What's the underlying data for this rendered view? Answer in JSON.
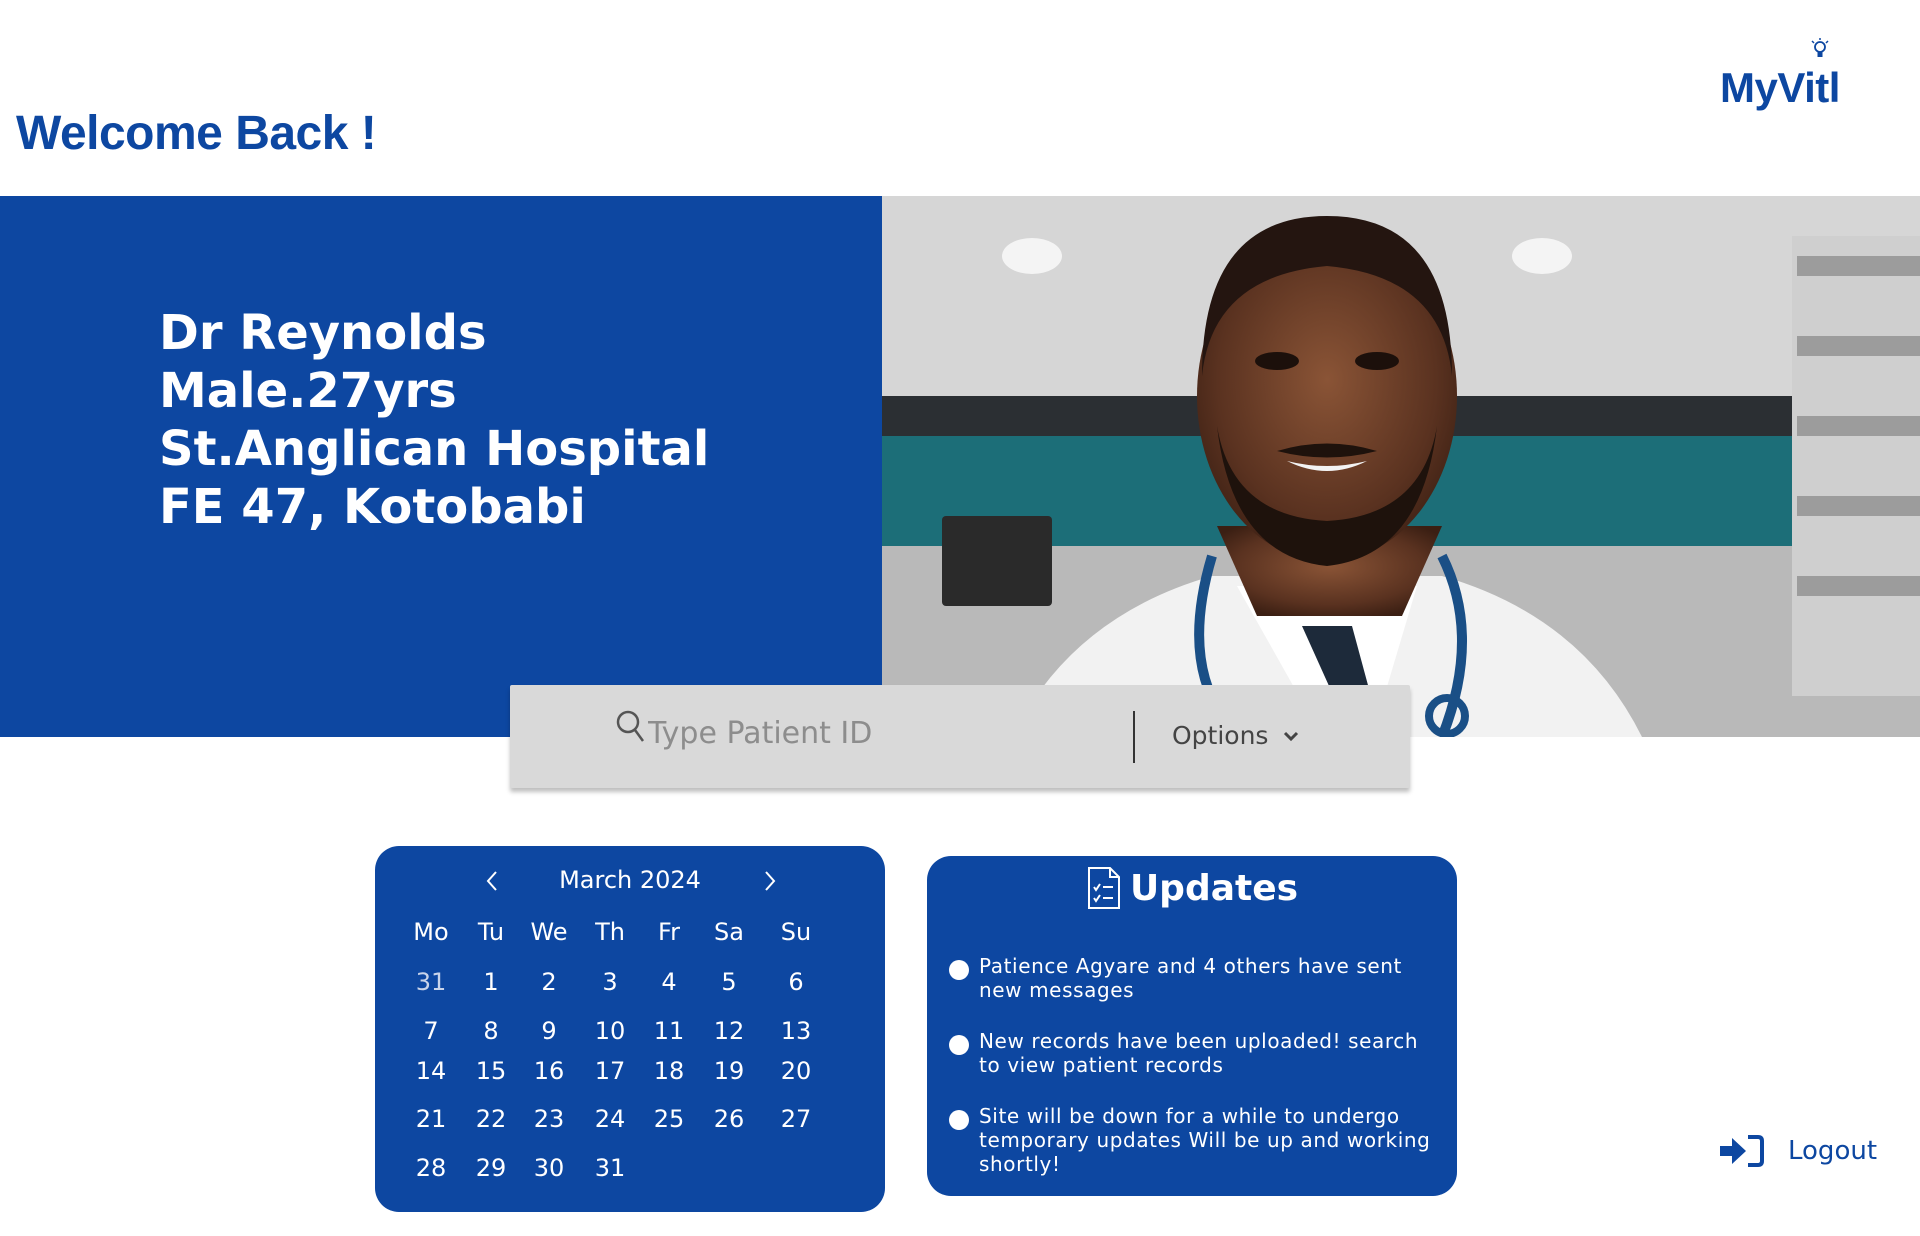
{
  "brand": {
    "name": "MyVitl",
    "icon": "lightbulb-icon",
    "color": "#0d47a1"
  },
  "header": {
    "welcome": "Welcome Back !"
  },
  "profile": {
    "name": "Dr Reynolds",
    "gender_age": "Male.27yrs",
    "hospital": "St.Anglican Hospital",
    "address": "FE 47, Kotobabi",
    "photo_description": "doctor-portrait"
  },
  "search": {
    "placeholder": "Type Patient ID",
    "value": "",
    "options_label": "Options"
  },
  "calendar": {
    "month_label": "March 2024",
    "weekdays": [
      "Mo",
      "Tu",
      "We",
      "Th",
      "Fr",
      "Sa",
      "Su"
    ],
    "weeks": [
      [
        "31",
        "1",
        "2",
        "3",
        "4",
        "5",
        "6"
      ],
      [
        "7",
        "8",
        "9",
        "10",
        "11",
        "12",
        "13"
      ],
      [
        "14",
        "15",
        "16",
        "17",
        "18",
        "19",
        "20"
      ],
      [
        "21",
        "22",
        "23",
        "24",
        "25",
        "26",
        "27"
      ],
      [
        "28",
        "29",
        "30",
        "31",
        "",
        "",
        ""
      ]
    ]
  },
  "updates": {
    "title": "Updates",
    "icon": "checklist-document-icon",
    "items": [
      "Patience Agyare and 4 others have sent new messages",
      "New records have been uploaded! search to view patient records",
      "Site will be down for a while to undergo temporary updates Will be up and working shortly!"
    ]
  },
  "logout": {
    "label": "Logout",
    "icon": "sign-in-arrow-icon"
  }
}
